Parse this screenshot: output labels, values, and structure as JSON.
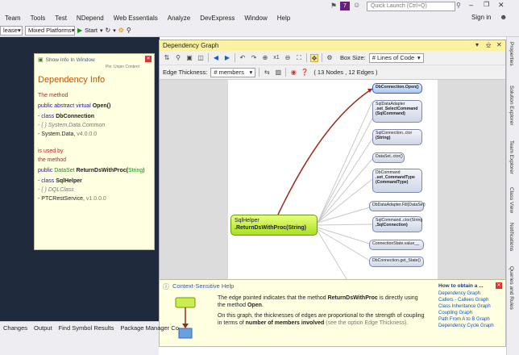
{
  "titlebar": {
    "quick_launch_placeholder": "Quick Launch (Ctrl+Q)",
    "badge": "7",
    "sign_in": "Sign in"
  },
  "menu": [
    "Team",
    "Tools",
    "Test",
    "NDepend",
    "Web Essentials",
    "Analyze",
    "DevExpress",
    "Window",
    "Help"
  ],
  "toolbar": {
    "config": "lease",
    "platform": "Mixed Platforms",
    "start": "Start"
  },
  "dep_info": {
    "show_info": "Show Info In Window",
    "pin": "Pin: Unpin Content",
    "title": "Dependency Info",
    "the_method": "The method",
    "sig_prefix": "public abstract virtual",
    "sig_name": "Open()",
    "class_prefix": "- class",
    "class_name": "DbConnection",
    "ns1": "- { } System.Data.Common",
    "asm1_name": "- System.Data,",
    "asm1_ver": "v4.0.0.0",
    "is_used_by": "is used by",
    "the_method2": "the method",
    "sig2_prefix": "public",
    "sig2_type": "DataSet",
    "sig2_name": "ReturnDsWithProc(",
    "sig2_param": "String",
    "sig2_end": ")",
    "class2_prefix": "- class",
    "class2_name": "SqlHelper",
    "ns2": "- { } DQLClass",
    "asm2_name": "- PTCRestService,",
    "asm2_ver": "v1.0.0.0"
  },
  "graph": {
    "title": "Dependency Graph",
    "box_size_label": "Box Size:",
    "box_size_value": "# Lines of Code",
    "edge_thickness_label": "Edge Thickness:",
    "edge_thickness_value": "# members",
    "counts": "( 13 Nodes , 12 Edges )",
    "main_node_line1": "SqlHelper",
    "main_node_line2": ".ReturnDsWithProc(String)",
    "nodes": [
      {
        "l1": "DbConnection.Open()",
        "l2": "",
        "l3": ""
      },
      {
        "l1": "SqlDataAdapter",
        "l2": ".set_SelectCommand",
        "l3": "(SqlCommand)"
      },
      {
        "l1": "SqlConnection..ctor",
        "l2": "(String)",
        "l3": ""
      },
      {
        "l1": "DataSet..ctor()",
        "l2": "",
        "l3": ""
      },
      {
        "l1": "DbCommand",
        "l2": ".set_CommandType",
        "l3": "(CommandType)"
      },
      {
        "l1": "DbDataAdapter.Fill(DataSet)",
        "l2": "",
        "l3": ""
      },
      {
        "l1": "SqlCommand..ctor(String",
        "l2": ",SqlConnection)",
        "l3": ""
      },
      {
        "l1": "ConnectionState.value__",
        "l2": "",
        "l3": ""
      },
      {
        "l1": "DbConnection.get_State()",
        "l2": "",
        "l3": ""
      }
    ]
  },
  "help": {
    "title": "Context-Sensitive Help",
    "p1_pre": "The edge pointed indicates that the method",
    "p1_b1": "ReturnDsWithProc",
    "p1_mid": "is directly using the method",
    "p1_b2": "Open",
    "p1_end": ".",
    "p2_pre": "On this graph, the thicknesses of edges are proportional to the strength of coupling in terms of",
    "p2_b": "number of members involved",
    "p2_end": "(see the option Edge Thickness).",
    "links_title": "How to obtain a ...",
    "links": [
      "Dependency Graph",
      "Callers - Callees Graph",
      "Class Inheritance Graph",
      "Coupling Graph",
      "Path From A to B Graph",
      "Dependency Cycle Graph"
    ]
  },
  "bottom_tabs": [
    "Changes",
    "Output",
    "Find Symbol Results",
    "Package Manager Co"
  ],
  "side_tabs": [
    "Properties",
    "Solution Explorer",
    "Team Explorer",
    "Class View",
    "Notifications",
    "Queries and Rules"
  ]
}
